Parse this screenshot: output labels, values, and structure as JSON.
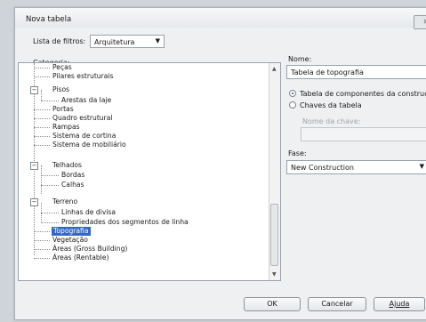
{
  "window": {
    "title": "Nova tabela",
    "close_glyph": "✕"
  },
  "filter": {
    "label": "Lista de filtros:",
    "value": "Arquitetura"
  },
  "category": {
    "label": "Categoria:",
    "items": [
      "Peças",
      "Pilares estruturais",
      "Pisos",
      "Arestas da laje",
      "Portas",
      "Quadro estrutural",
      "Rampas",
      "Sistema de cortina",
      "Sistema de mobiliário",
      "Telhados",
      "Bordas",
      "Calhas",
      "Terreno",
      "Linhas de divisa",
      "Propriedades dos segmentos de linha",
      "Topografia",
      "Vegetação",
      "Áreas (Gross Building)",
      "Áreas (Rentable)"
    ],
    "selected": "Topografia"
  },
  "name": {
    "label": "Nome:",
    "value": "Tabela de topografia"
  },
  "options": {
    "schedule_components": "Tabela de componentes da construção",
    "schedule_keys": "Chaves da tabela",
    "key_name_label": "Nome da chave:",
    "key_name_value": ""
  },
  "phase": {
    "label": "Fase:",
    "value": "New Construction"
  },
  "buttons": {
    "ok": "OK",
    "cancel": "Cancelar",
    "help": "Ajuda"
  }
}
